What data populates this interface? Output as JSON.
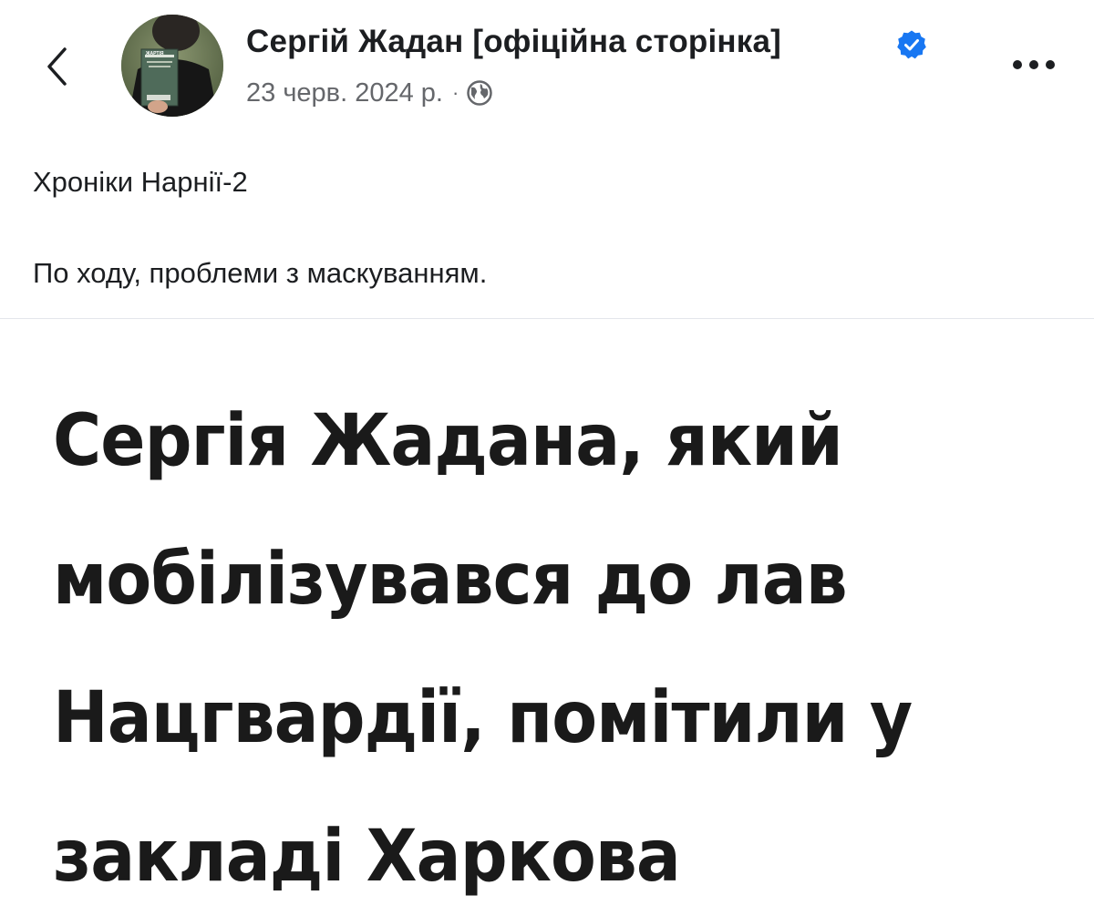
{
  "post": {
    "author_name": "Сергій Жадан [офіційна сторінка]",
    "verified_icon": "verified-badge-icon",
    "date": "23 черв. 2024 р.",
    "separator": "·",
    "audience_icon": "globe-icon",
    "text_line_1": "Хроніки Нарнії-2",
    "text_line_2": "По ходу, проблеми з маскуванням.",
    "avatar_book_title": "ЖАРТІЯ"
  },
  "navigation": {
    "back_icon": "chevron-left-icon",
    "more_icon": "more-horizontal-icon"
  },
  "attached_image": {
    "headline": "Сергія Жадана, який\nмобілізувався до лав\nНацгвардії, помітили у\nзакладі Харкова"
  },
  "colors": {
    "text_primary": "#1c1e21",
    "text_secondary": "#65676b",
    "verified_blue": "#1877f2",
    "headline_text": "#1a1a1a"
  }
}
